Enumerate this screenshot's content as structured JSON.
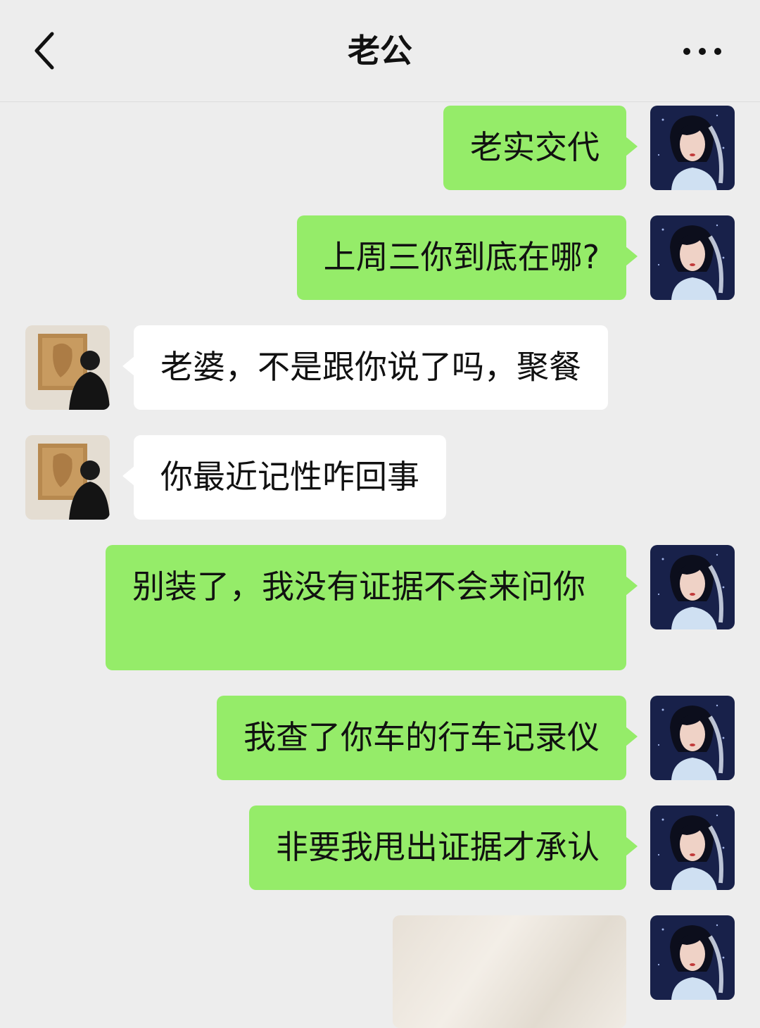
{
  "header": {
    "title": "老公"
  },
  "messages": [
    {
      "side": "me",
      "text": "老实交代"
    },
    {
      "side": "me",
      "text": "上周三你到底在哪?"
    },
    {
      "side": "him",
      "text": "老婆，不是跟你说了吗，聚餐"
    },
    {
      "side": "him",
      "text": "你最近记性咋回事"
    },
    {
      "side": "me",
      "text": "别装了，我没有证据不会来问你"
    },
    {
      "side": "me",
      "text": "我查了你车的行车记录仪"
    },
    {
      "side": "me",
      "text": "非要我甩出证据才承认"
    },
    {
      "side": "me",
      "type": "image"
    }
  ],
  "icons": {
    "back": "chevron-left-icon",
    "more": "more-dots-icon"
  },
  "colors": {
    "my_bubble": "#95ec69",
    "his_bubble": "#ffffff",
    "background": "#ededed"
  }
}
